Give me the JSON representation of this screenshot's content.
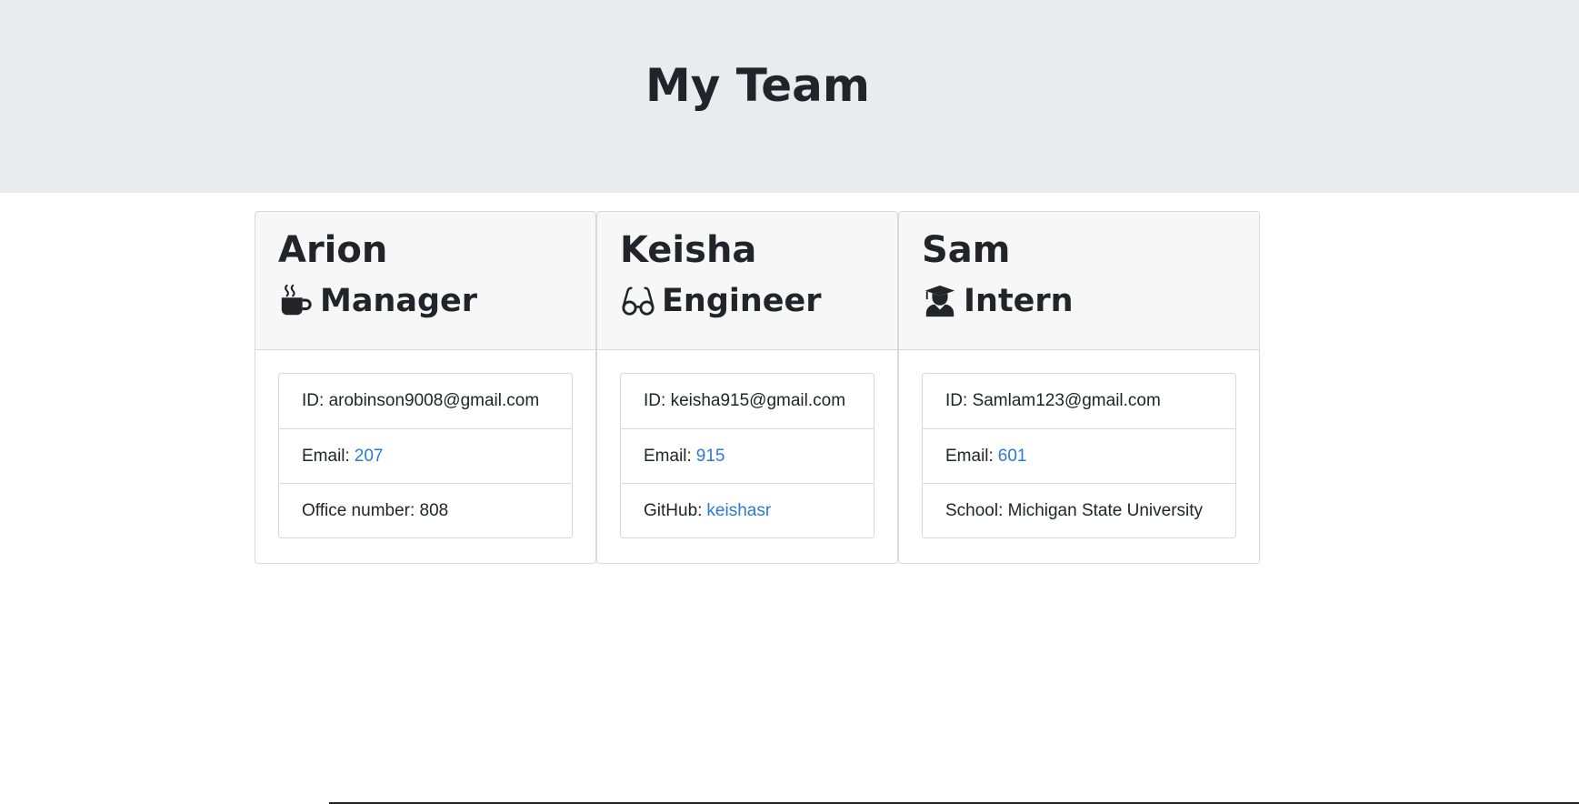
{
  "page": {
    "title": "My Team"
  },
  "cards": [
    {
      "name": "Arion",
      "role": "Manager",
      "icon": "mug-hot-icon",
      "items": [
        {
          "label": "ID:",
          "value": "arobinson9008@gmail.com"
        },
        {
          "label": "Email:",
          "value": "207"
        },
        {
          "label": "Office number:",
          "value": "808"
        }
      ]
    },
    {
      "name": "Keisha",
      "role": "Engineer",
      "icon": "glasses-icon",
      "items": [
        {
          "label": "ID:",
          "value": "keisha915@gmail.com"
        },
        {
          "label": "Email:",
          "value": "915"
        },
        {
          "label": "GitHub:",
          "value": "keishasr"
        }
      ]
    },
    {
      "name": "Sam",
      "role": "Intern",
      "icon": "user-graduate-icon",
      "items": [
        {
          "label": "ID:",
          "value": "Samlam123@gmail.com"
        },
        {
          "label": "Email:",
          "value": "601"
        },
        {
          "label": "School:",
          "value": "Michigan State University"
        }
      ]
    }
  ],
  "colors": {
    "header_bg": "#e9ecef",
    "card_header_bg": "#f7f7f7",
    "link": "#2b7ad6"
  }
}
